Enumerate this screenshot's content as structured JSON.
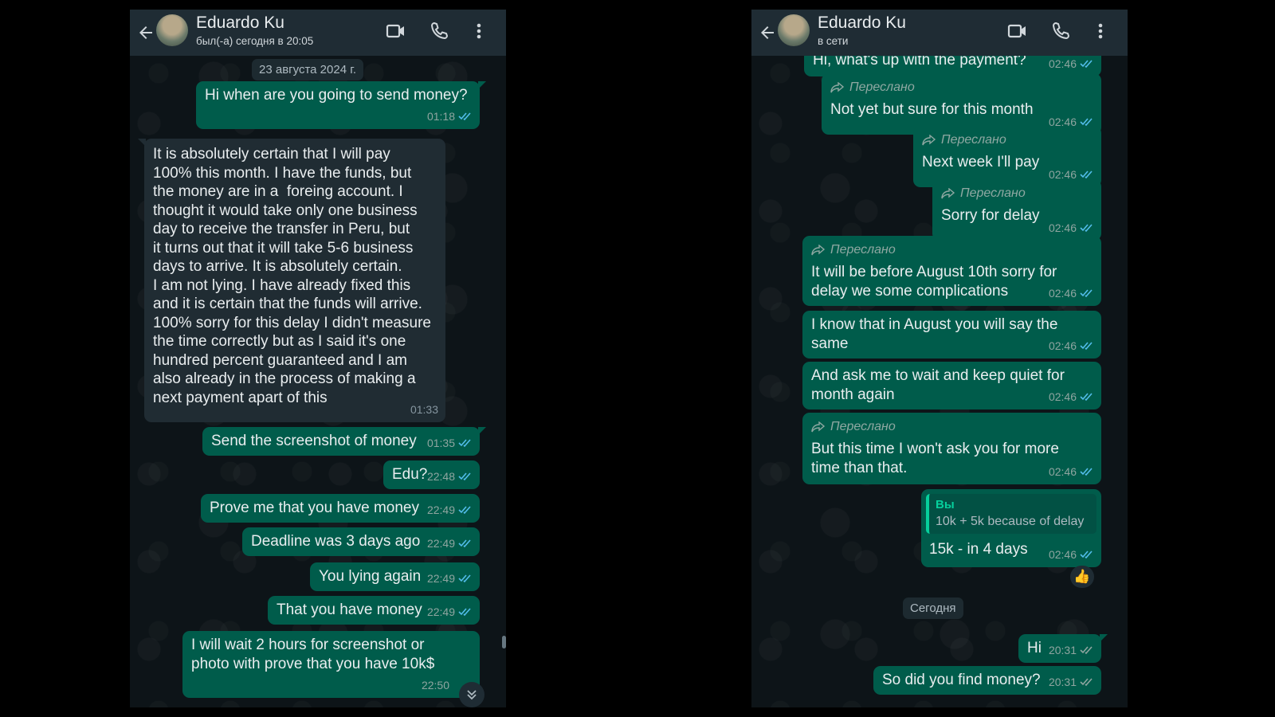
{
  "left": {
    "header": {
      "name": "Eduardo Ku",
      "status": "был(-а) сегодня в 20:05"
    },
    "date_separator": "23 августа 2024 г.",
    "messages": [
      {
        "dir": "out",
        "text": "Hi when are you going to send money?",
        "time": "01:18"
      },
      {
        "dir": "in",
        "text": "It is absolutely certain that I will pay\n100% this month. I have the funds, but\nthe money are in a  foreing account. I\nthought it would take only one business\nday to receive the transfer in Peru, but\nit turns out that it will take 5-6 business\ndays to arrive. It is absolutely certain.\nI am not lying. I have already fixed this\nand it is certain that the funds will arrive.\n100% sorry for this delay I didn't measure\nthe time correctly but as I said it's one\nhundred percent guaranteed and I am\nalso already in the process of making a\nnext payment apart of this",
        "time": "01:33"
      },
      {
        "dir": "out",
        "text": "Send the screenshot of money",
        "time": "01:35"
      },
      {
        "dir": "out",
        "text": "Edu?",
        "time": "22:48"
      },
      {
        "dir": "out",
        "text": "Prove me that you have money",
        "time": "22:49"
      },
      {
        "dir": "out",
        "text": "Deadline was 3 days ago",
        "time": "22:49"
      },
      {
        "dir": "out",
        "text": "You lying again",
        "time": "22:49"
      },
      {
        "dir": "out",
        "text": "That you have money",
        "time": "22:49"
      },
      {
        "dir": "out",
        "text": "I will wait 2 hours for screenshot or\nphoto with prove that you have 10k$",
        "time": "22:50"
      }
    ]
  },
  "right": {
    "header": {
      "name": "Eduardo Ku",
      "status": "в сети"
    },
    "day_separator": "Сегодня",
    "forwarded_label": "Переслано",
    "messages": [
      {
        "dir": "out",
        "text": "Hi, what's up with the payment?",
        "time": "02:46"
      },
      {
        "dir": "out",
        "forwarded": true,
        "text": "Not yet but sure for this month",
        "time": "02:46"
      },
      {
        "dir": "out",
        "forwarded": true,
        "text": "Next week I'll pay",
        "time": "02:46"
      },
      {
        "dir": "out",
        "forwarded": true,
        "text": "Sorry for delay",
        "time": "02:46"
      },
      {
        "dir": "out",
        "forwarded": true,
        "text": "It will be before August 10th sorry for\ndelay we some complications",
        "time": "02:46"
      },
      {
        "dir": "out",
        "text": "I know that in August you will say the\nsame",
        "time": "02:46"
      },
      {
        "dir": "out",
        "text": "And ask me to wait and keep quiet for\nmonth again",
        "time": "02:46"
      },
      {
        "dir": "out",
        "forwarded": true,
        "text": "But this time I won't ask you for more\ntime than that.",
        "time": "02:46"
      },
      {
        "dir": "out",
        "quote": {
          "author": "Вы",
          "text": "10k + 5k because of delay"
        },
        "text": "15k - in 4 days",
        "time": "02:46",
        "reaction": "👍"
      },
      {
        "dir": "out",
        "text": "Hi",
        "time": "20:31"
      },
      {
        "dir": "out",
        "text": "So did you find money?",
        "time": "20:31"
      }
    ]
  },
  "colors": {
    "header": "#1f2c34",
    "background": "#0d1418",
    "outgoing": "#005c4b",
    "incoming": "#202c33",
    "ticks_read": "#53bdeb",
    "accent": "#06cf9c"
  },
  "icons": [
    "back-arrow-icon",
    "video-call-icon",
    "phone-icon",
    "menu-dots-icon",
    "double-check-icon",
    "forward-icon",
    "scroll-down-icon"
  ]
}
